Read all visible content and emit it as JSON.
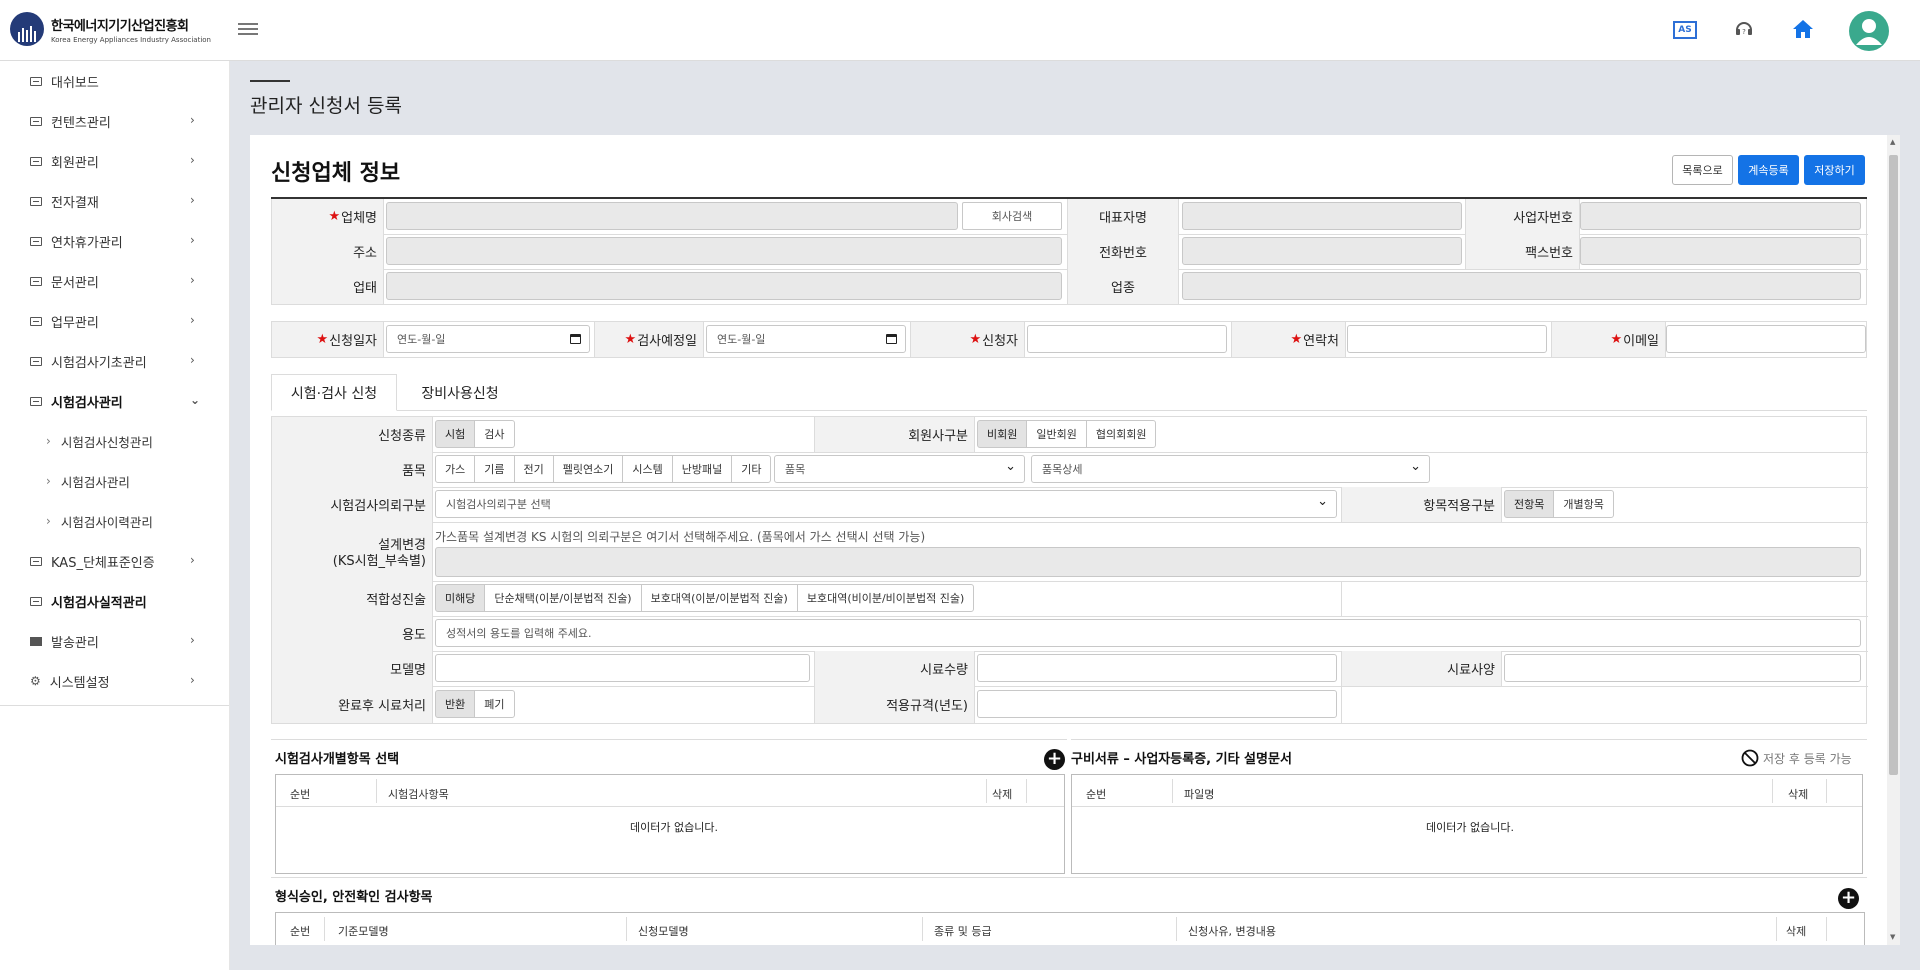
{
  "header": {
    "logo_ko": "한국에너지기기산업진흥회",
    "logo_en": "Korea Energy Appliances Industry Association",
    "as_label": "AS"
  },
  "sidebar": {
    "items": [
      {
        "label": "대쉬보드"
      },
      {
        "label": "컨텐츠관리"
      },
      {
        "label": "회원관리"
      },
      {
        "label": "전자결재"
      },
      {
        "label": "연차휴가관리"
      },
      {
        "label": "문서관리"
      },
      {
        "label": "업무관리"
      },
      {
        "label": "시험검사기초관리"
      },
      {
        "label": "시험검사관리"
      },
      {
        "label": "KAS_단체표준인증"
      },
      {
        "label": "시험검사실적관리"
      },
      {
        "label": "발송관리"
      },
      {
        "label": "시스템설정"
      }
    ],
    "subitems": [
      {
        "label": "시험검사신청관리"
      },
      {
        "label": "시험검사관리"
      },
      {
        "label": "시험검사이력관리"
      }
    ]
  },
  "page": {
    "title": "관리자 신청서 등록"
  },
  "card": {
    "title": "신청업체 정보",
    "btn_list": "목록으로",
    "btn_continue": "계속등록",
    "btn_save": "저장하기"
  },
  "company": {
    "name_label": "업체명",
    "search_btn": "회사검색",
    "rep_label": "대표자명",
    "bizno_label": "사업자번호",
    "addr_label": "주소",
    "phone_label": "전화번호",
    "fax_label": "팩스번호",
    "biztype_label": "업태",
    "bizitem_label": "업종"
  },
  "application": {
    "date_label": "신청일자",
    "date_placeholder": "연도-월-일",
    "inspect_date_label": "검사예정일",
    "inspect_date_placeholder": "연도-월-일",
    "applicant_label": "신청자",
    "contact_label": "연락처",
    "email_label": "이메일"
  },
  "tabs": [
    {
      "label": "시험·검사 신청"
    },
    {
      "label": "장비사용신청"
    }
  ],
  "form": {
    "type_label": "신청종류",
    "type_options": [
      "시험",
      "검사"
    ],
    "member_label": "회원사구분",
    "member_options": [
      "비회원",
      "일반회원",
      "협의회회원"
    ],
    "item_label": "품목",
    "item_options": [
      "가스",
      "기름",
      "전기",
      "펠릿연소기",
      "시스템",
      "난방패널",
      "기타"
    ],
    "item_select": "품목",
    "item_detail_select": "품목상세",
    "request_label": "시험검사의뢰구분",
    "request_select": "시험검사의뢰구분 선택",
    "apply_label": "항목적용구분",
    "apply_options": [
      "전항목",
      "개별항목"
    ],
    "design_label_1": "설계변경",
    "design_label_2": "(KS시험_부속별)",
    "design_hint": "가스품목 설계변경 KS 시험의 의뢰구분은 여기서 선택해주세요. (품목에서 가스 선택시 선택 가능)",
    "conform_label": "적합성진술",
    "conform_options": [
      "미해당",
      "단순채택(이분/이분법적 진술)",
      "보호대역(이분/이분법적 진술)",
      "보호대역(비이분/비이분법적 진술)"
    ],
    "usage_label": "용도",
    "usage_placeholder": "성적서의 용도를 입력해 주세요.",
    "model_label": "모델명",
    "sample_qty_label": "시료수량",
    "sample_spec_label": "시료사양",
    "after_label": "완료후 시료처리",
    "after_options": [
      "반환",
      "폐기"
    ],
    "standard_label": "적용규격(년도)"
  },
  "individual": {
    "title": "시험검사개별항목 선택",
    "cols": [
      "순번",
      "시험검사항목",
      "삭제"
    ],
    "empty": "데이터가 없습니다."
  },
  "documents": {
    "title": "구비서류 – 사업자등록증, 기타 설명문서",
    "note": "저장 후 등록 가능",
    "cols": [
      "순번",
      "파일명",
      "삭제"
    ],
    "empty": "데이터가 없습니다."
  },
  "type_approval": {
    "title": "형식승인, 안전확인 검사항목",
    "cols": [
      "순번",
      "기준모델명",
      "신청모델명",
      "종류 및 등급",
      "신청사유, 변경내용",
      "삭제"
    ]
  }
}
